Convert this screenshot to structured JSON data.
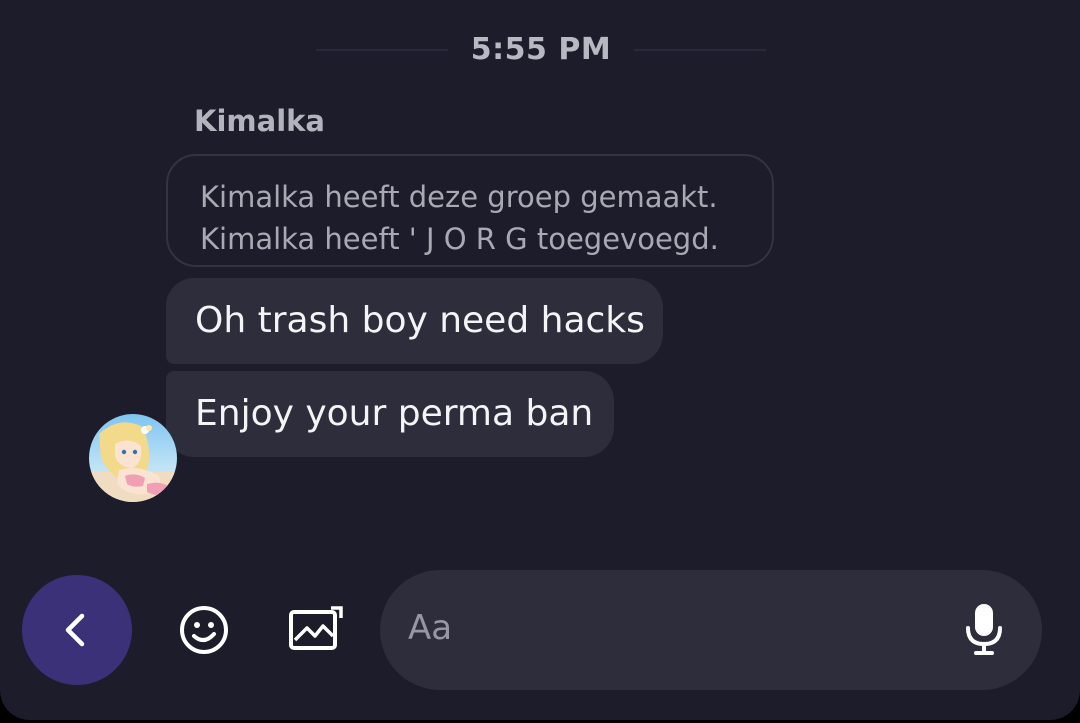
{
  "header": {
    "timestamp": "5:55 PM"
  },
  "conversation": {
    "sender_name": "Kimalka",
    "system_messages": [
      "Kimalka heeft deze groep gemaakt.",
      "Kimalka heeft ' J O R G toegevoegd."
    ],
    "messages": [
      {
        "text": "Oh trash boy need hacks"
      },
      {
        "text": "Enjoy your perma ban"
      }
    ]
  },
  "composer": {
    "placeholder": "Aa",
    "icons": {
      "back": "chevron-left-icon",
      "emoji": "smiley-icon",
      "gallery": "image-icon",
      "mic": "microphone-icon"
    }
  },
  "colors": {
    "background": "#1d1c2b",
    "bubble": "#2e2d3c",
    "accent": "#3b3178"
  }
}
